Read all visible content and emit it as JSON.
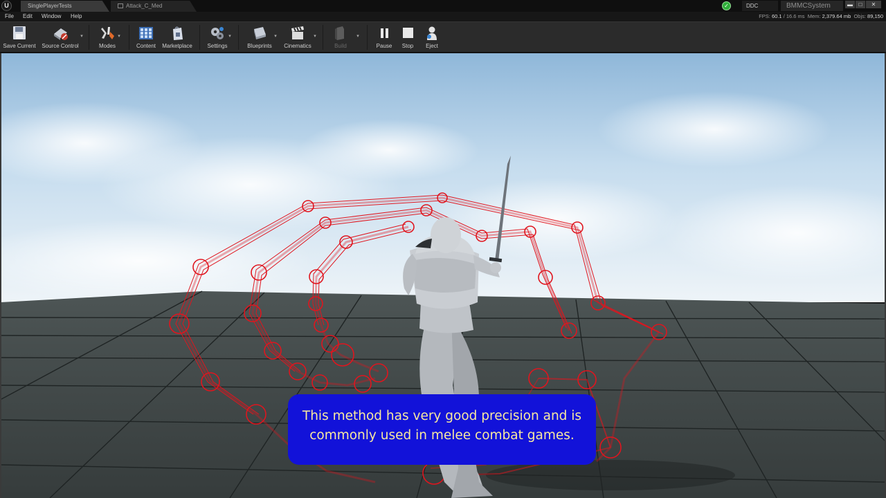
{
  "window": {
    "logo": "U",
    "tabs": [
      {
        "label": "SinglePlayerTests",
        "active": true
      },
      {
        "label": "Attack_C_Med",
        "active": false
      }
    ],
    "ddc_label": "DDC",
    "project_name": "BMMCSystem",
    "controls": {
      "minimize": "▬",
      "maximize": "□",
      "close": "✕"
    }
  },
  "menu": {
    "items": [
      "File",
      "Edit",
      "Window",
      "Help"
    ]
  },
  "perf": {
    "fps_label": "FPS:",
    "fps_value": "60.1",
    "frame_time": "/ 16.6 ms",
    "mem_label": "Mem:",
    "mem_value": "2,379.64 mb",
    "objs_label": "Objs:",
    "objs_value": "89,150"
  },
  "toolbar": {
    "save_current": "Save Current",
    "source_control": "Source Control",
    "modes": "Modes",
    "content": "Content",
    "marketplace": "Marketplace",
    "settings": "Settings",
    "blueprints": "Blueprints",
    "cinematics": "Cinematics",
    "build": "Build",
    "pause": "Pause",
    "stop": "Stop",
    "eject": "Eject",
    "dropdown_glyph": "▾"
  },
  "subtitle": {
    "line1": "This method has very good precision and is",
    "line2": "commonly used in melee combat games."
  },
  "colors": {
    "trace_red": "#e0151e",
    "subtitle_bg": "#1212d9",
    "subtitle_text": "#f6e8a0",
    "ddc_green": "#2fae3a"
  },
  "icons": {
    "save": "floppy-disk-icon",
    "source_control": "source-control-icon",
    "modes": "modes-wrench-icon",
    "content": "content-grid-icon",
    "marketplace": "marketplace-bag-icon",
    "settings": "settings-gears-icon",
    "blueprints": "blueprint-icon",
    "cinematics": "clapperboard-icon",
    "build": "build-icon",
    "pause": "pause-icon",
    "stop": "stop-icon",
    "eject": "eject-icon"
  }
}
